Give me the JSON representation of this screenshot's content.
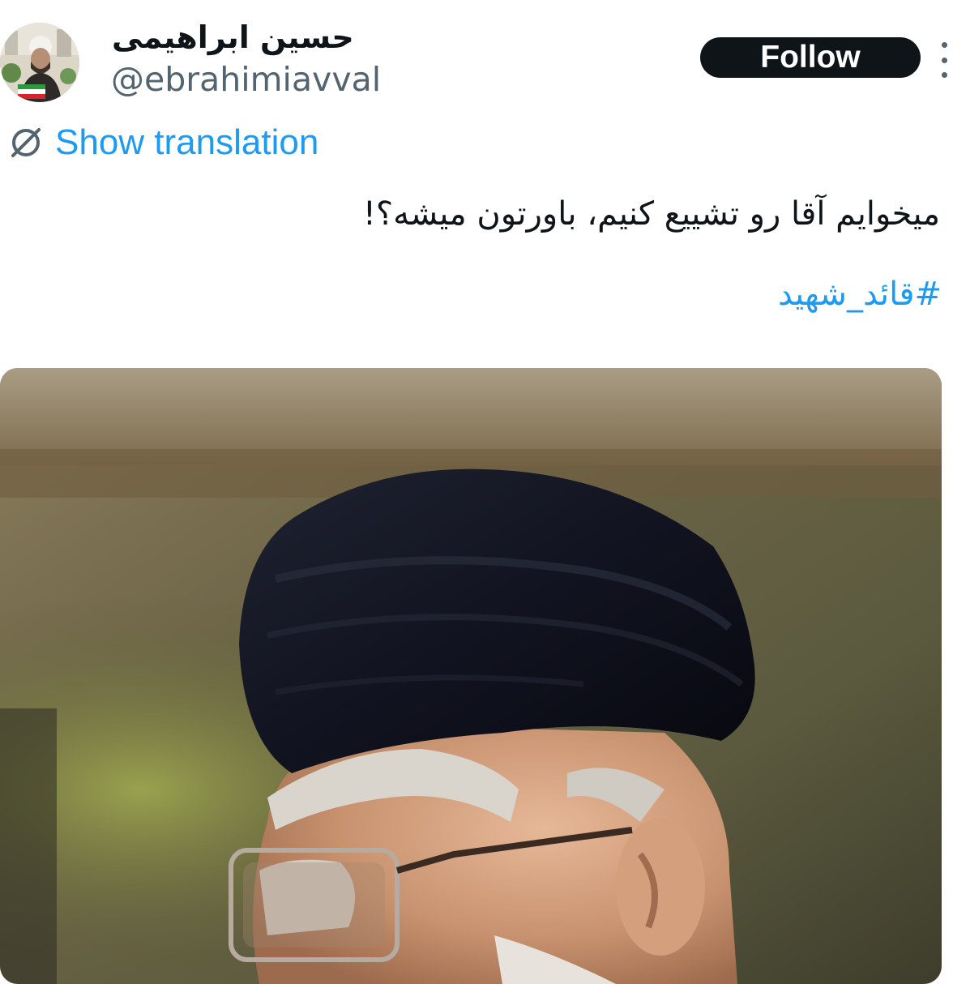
{
  "tweet": {
    "author": {
      "display_name": "حسین ابراهیمی",
      "handle": "@ebrahimiavval",
      "avatar_icon": "profile-photo"
    },
    "follow_label": "Follow",
    "more_icon": "more-options-icon",
    "translate": {
      "icon": "translate-globe-icon",
      "label": "Show translation"
    },
    "text": "میخوایم آقا رو تشییع کنیم، باورتون میشه؟!",
    "hashtag": "#قائد_شهید",
    "media": {
      "type": "photo"
    }
  },
  "colors": {
    "link": "#1d9bf0",
    "text_primary": "#0f1419",
    "text_secondary": "#536471",
    "follow_bg": "#0f1419",
    "follow_text": "#ffffff"
  }
}
